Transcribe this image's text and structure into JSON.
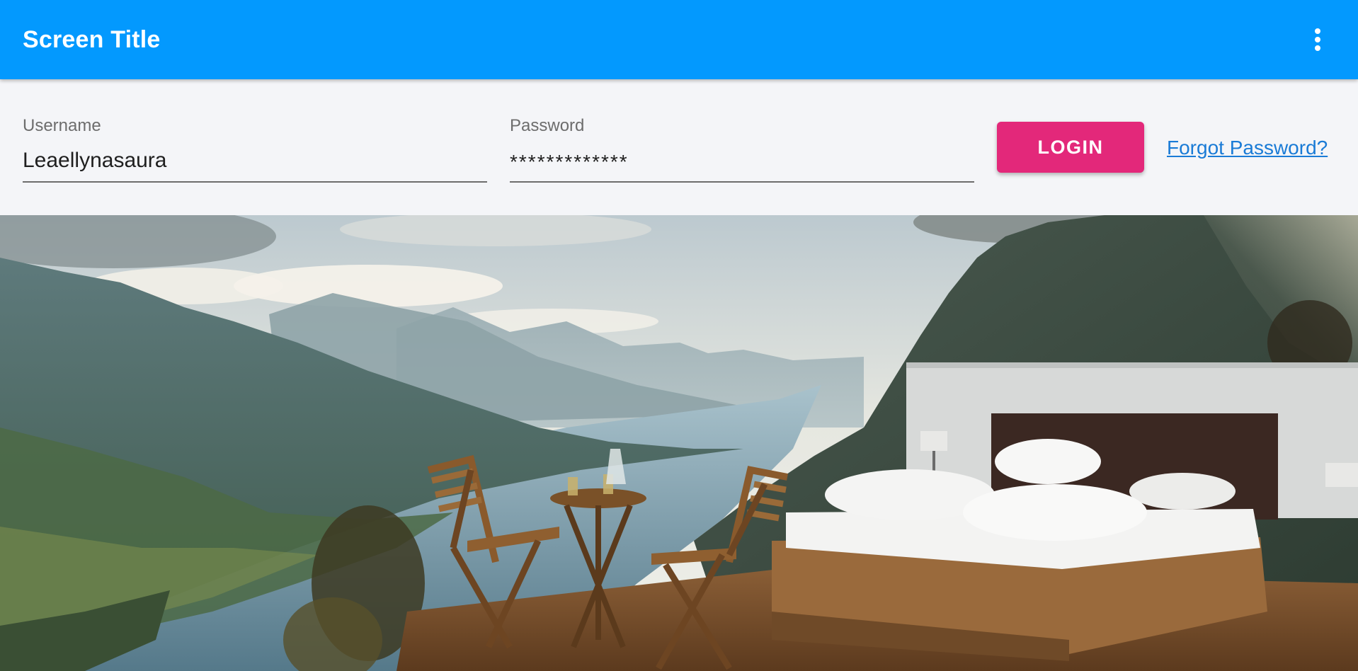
{
  "app_bar": {
    "title": "Screen Title",
    "overflow_icon": "more-vert-icon"
  },
  "login_form": {
    "username": {
      "label": "Username",
      "value": "Leaellynasaura"
    },
    "password": {
      "label": "Password",
      "value": "*************"
    },
    "login_button_label": "LOGIN",
    "forgot_password_label": "Forgot Password?"
  },
  "hero": {
    "image": "hero-photo-mountain-lake-outdoor-bed"
  },
  "colors": {
    "app_bar": "#0399fe",
    "accent_button": "#e3287a",
    "link": "#1a7bd6",
    "form_background": "#f4f5f8"
  }
}
